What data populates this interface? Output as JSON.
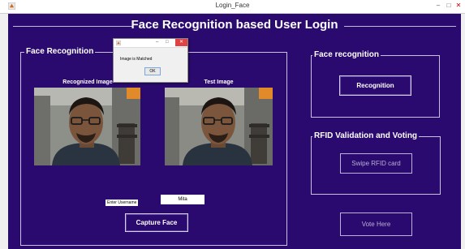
{
  "window": {
    "title": "Login_Face",
    "minimize": "–",
    "maximize": "□",
    "close": "✕"
  },
  "app": {
    "title": "Face Recognition based User Login",
    "background_color": "#2a0a6e"
  },
  "face_panel": {
    "title": "Face Recognition",
    "recognized_label": "Recognized Image",
    "test_label": "Test Image",
    "username_label": "Enter Username",
    "username_value": "Mita",
    "capture_button": "Capture Face"
  },
  "recognition_panel": {
    "title": "Face recognition",
    "button": "Recognition"
  },
  "rfid_panel": {
    "title": "RFID Validation and Voting",
    "button": "Swipe RFID card"
  },
  "vote_button": "Vote Here",
  "dialog": {
    "minimize": "–",
    "maximize": "□",
    "close": "✕",
    "message": "Image is Matched",
    "ok": "OK"
  }
}
